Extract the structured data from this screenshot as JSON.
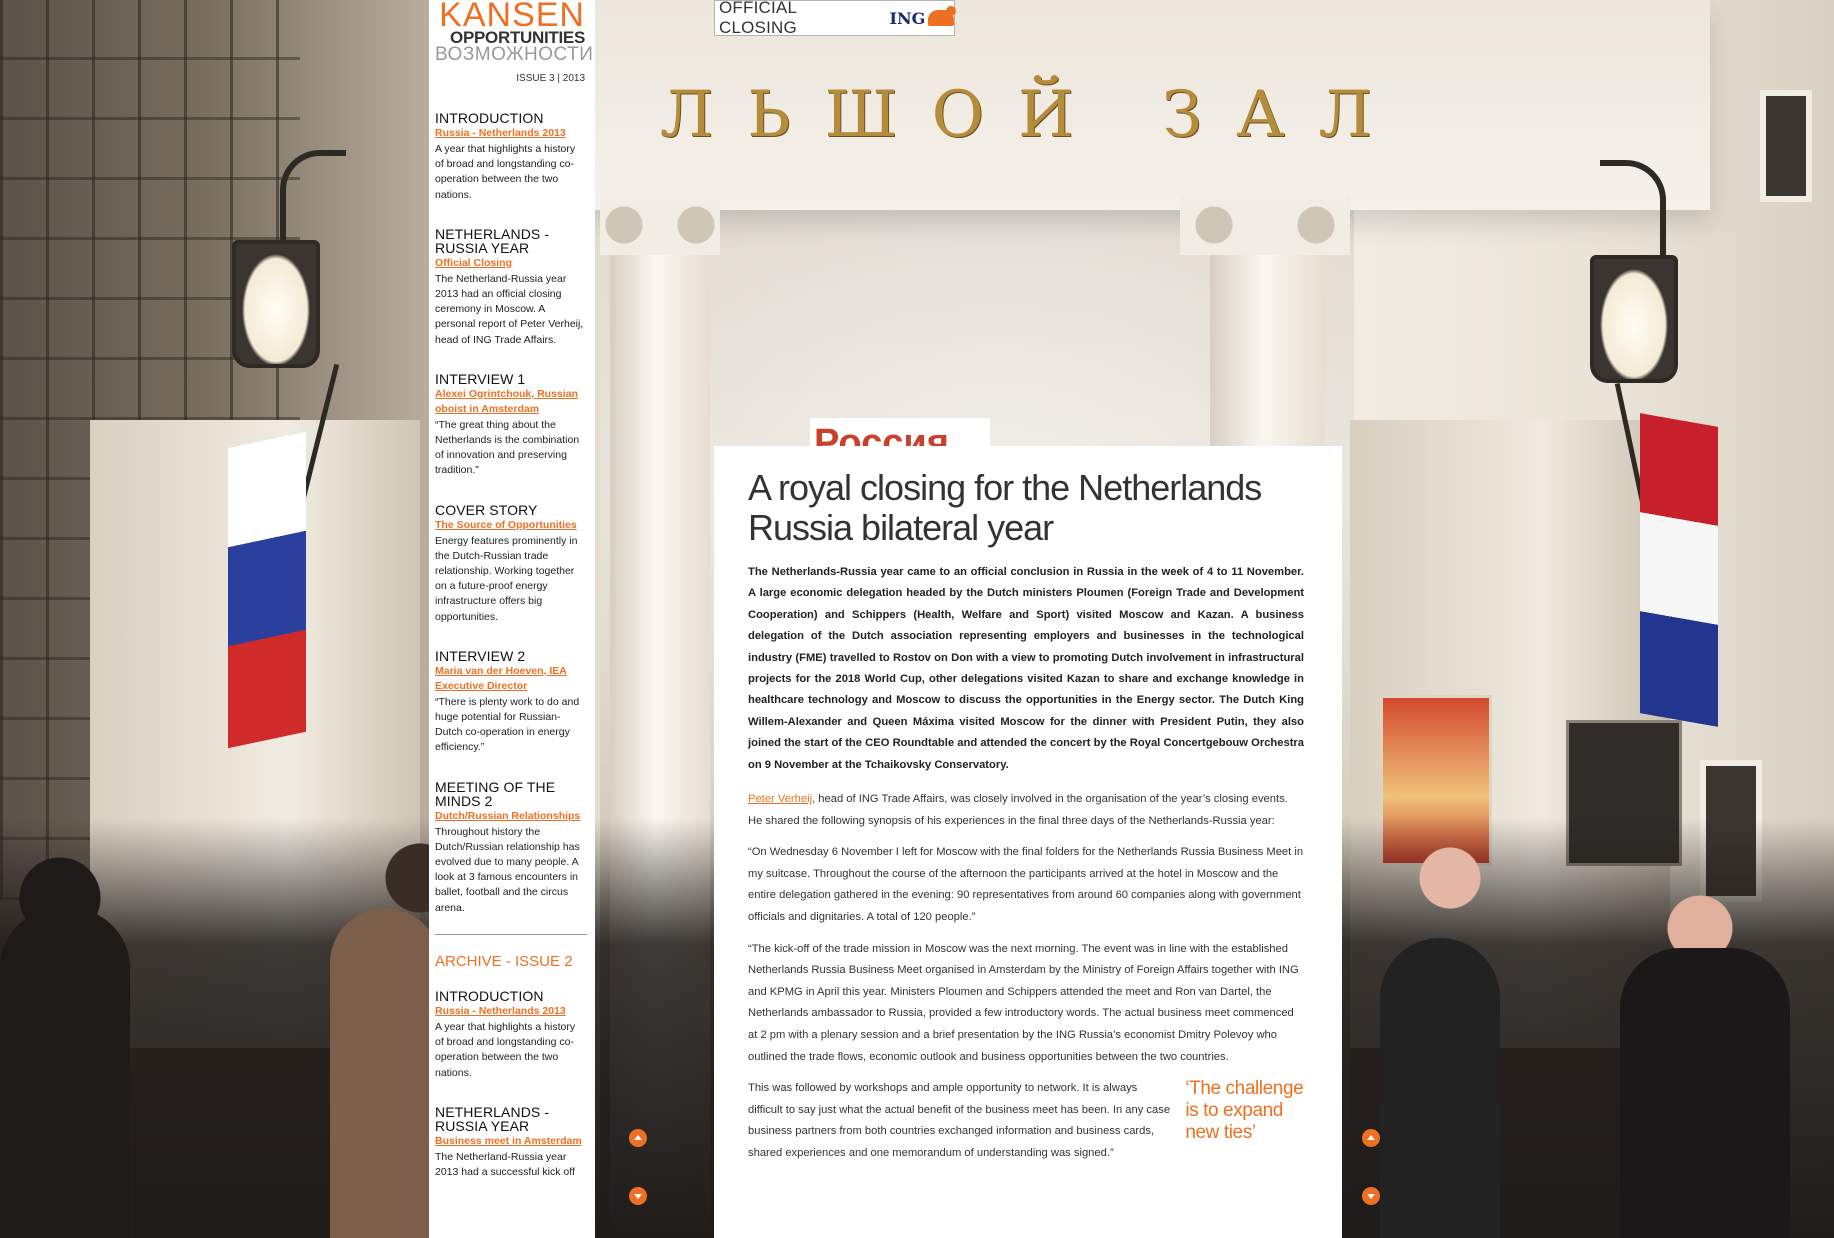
{
  "badge": {
    "label": "OFFICIAL CLOSING",
    "brand": "ING"
  },
  "logo": {
    "line1": "KANSEN",
    "line2": "OPPORTUNITIES",
    "line3": "ВОЗМОЖНОСТИ"
  },
  "issue": "ISSUE 3 | 2013",
  "sidebar": {
    "current": [
      {
        "title": "INTRODUCTION",
        "link": "Russia - Netherlands 2013",
        "text": "A year that highlights a history of broad and longstanding co-operation between the two nations."
      },
      {
        "title": "NETHERLANDS - RUSSIA YEAR",
        "link": "Official Closing",
        "text": "The Netherland-Russia year 2013 had an official closing ceremony in Moscow. A personal report of Peter Verheij, head of ING Trade Affairs."
      },
      {
        "title": "INTERVIEW 1",
        "link": "Alexei Ogrintchouk, Russian oboist in Amsterdam",
        "text": "“The great thing about the Netherlands is the combination of innovation and preserving tradition.”"
      },
      {
        "title": "COVER STORY",
        "link": "The Source of Opportunities",
        "text": "Energy features prominently in the Dutch-Russian trade relationship. Working together on a future-proof energy infrastructure offers big opportunities."
      },
      {
        "title": "INTERVIEW 2",
        "link": "Maria van der Hoeven, IEA Executive Director",
        "text": "“There is plenty work to do and huge potential for Russian-Dutch co-operation in energy efficiency.”"
      },
      {
        "title": "MEETING OF THE MINDS 2",
        "link": "Dutch/Russian Relationships",
        "text": "Throughout history the Dutch/Russian relationship has evolved due to many people. A look at 3 famous encounters in ballet, football and the circus arena."
      }
    ],
    "archive_title": "ARCHIVE - ISSUE 2",
    "archive": [
      {
        "title": "INTRODUCTION",
        "link": "Russia - Netherlands 2013",
        "text": "A year that highlights a history of broad and longstanding co-operation between the two nations."
      },
      {
        "title": "NETHERLANDS - RUSSIA YEAR",
        "link": "Business meet in Amsterdam",
        "text": "The Netherland-Russia year 2013 had a successful kick off"
      }
    ]
  },
  "background": {
    "carved_text": "ЛЬШОЙ ЗАЛ",
    "banner_text": "Россия"
  },
  "article": {
    "headline": "A royal closing for the Netherlands Russia bilateral year",
    "lead": "The Netherlands-Russia year came to an official conclusion in Russia in the week of 4 to 11 November. A large economic delegation headed by the Dutch ministers Ploumen (Foreign Trade and Development Cooperation) and Schippers (Health, Welfare and Sport) visited Moscow and Kazan. A business delegation of the Dutch association representing employers and businesses in the technological industry (FME) travelled to Rostov on Don with a view to promoting Dutch involvement in infrastructural projects for the 2018 World Cup, other delegations visited Kazan to share and exchange knowledge in healthcare technology and Moscow to discuss the opportunities in the Energy sector. The Dutch King Willem-Alexander and Queen Máxima visited Moscow for the dinner with President Putin, they also joined the start of the CEO Roundtable and attended the concert by the Royal Concertgebouw Orchestra on 9 November at the Tchaikovsky Conservatory.",
    "author_link": "Peter Verheij",
    "p1_rest": ", head of ING Trade Affairs, was closely involved in the organisation of the year’s closing events. He shared the following synopsis of his experiences in the final three days of the Netherlands-Russia year:",
    "p2": "“On Wednesday 6 November I left for Moscow with the final folders for the Netherlands Russia Business Meet in my suitcase. Throughout the course of the afternoon the participants arrived at the hotel in Moscow and the entire delegation gathered in the evening: 90 representatives from around 60 companies along with government officials and dignitaries. A total of 120 people.”",
    "p3": "“The kick-off of the trade mission in Moscow was the next morning. The event was in line with the established Netherlands Russia Business Meet organised in Amsterdam by the Ministry of Foreign Affairs together with ING and KPMG in April this year. Ministers Ploumen and Schippers attended the meet and Ron van Dartel, the Netherlands ambassador to Russia, provided a few introductory words. The actual business meet commenced at 2 pm with a plenary session and a brief presentation by the ING Russia’s economist Dmitry Polevoy who outlined the trade flows, economic outlook and business opportunities between the two countries.",
    "p4": "This was followed by workshops and ample opportunity to network. It is always difficult to say just what the actual benefit of the business meet has been. In any case business partners from both countries exchanged information and business cards, shared experiences and one memorandum of understanding was signed.”",
    "pullquote": "‘The challenge is to expand new ties’"
  },
  "colors": {
    "accent": "#ee7023",
    "ing_blue": "#1c2a6e"
  },
  "icons": {
    "scroll_up": "arrow-up-icon",
    "scroll_down": "arrow-down-icon",
    "ing_logo": "lion-icon"
  }
}
